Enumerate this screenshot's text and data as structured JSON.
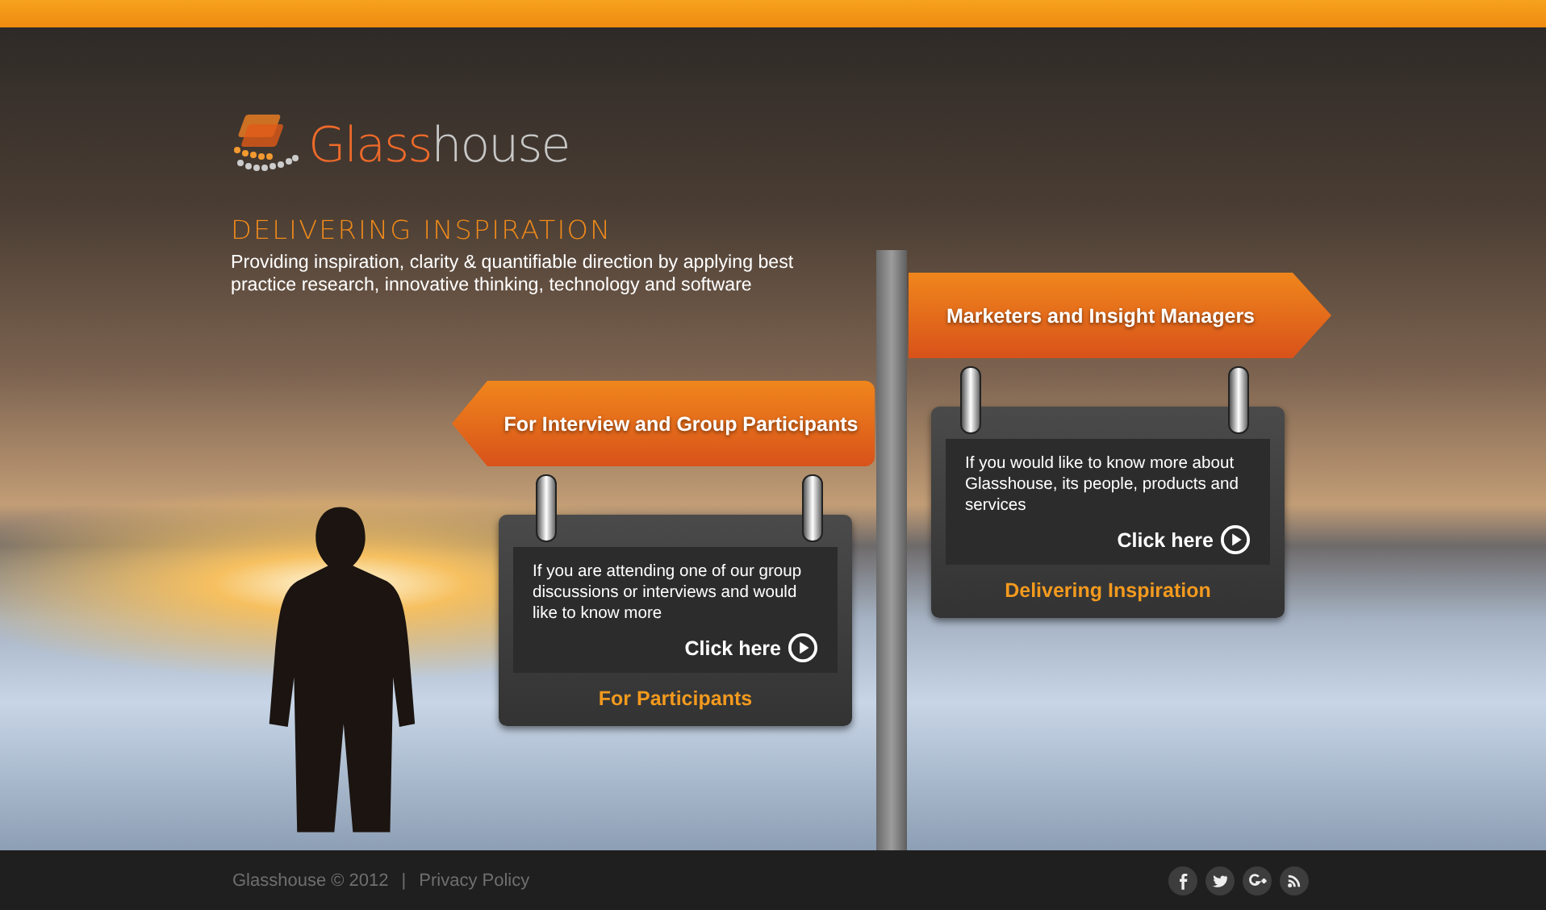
{
  "logo": {
    "prefix": "Glass",
    "suffix": "house"
  },
  "tagline": "DELIVERING INSPIRATION",
  "intro": "Providing inspiration, clarity & quantifiable direction by applying best practice research, innovative thinking, technology and software",
  "signs": [
    {
      "title": "For Interview and Group Participants",
      "kind": "left",
      "text": "If you are attending one of our group discussions or interviews and would like to know more",
      "link": "Click here",
      "footer": "For Participants"
    },
    {
      "title": "Marketers and Insight Managers",
      "kind": "right",
      "text": "If you would like to know more about Glasshouse, its people, products and services",
      "link": "Click here",
      "footer": "Delivering Inspiration"
    }
  ],
  "footer": {
    "copyright": "Glasshouse © 2012",
    "separator": "|",
    "privacy": "Privacy Policy"
  },
  "social": [
    {
      "kind": "facebook"
    },
    {
      "kind": "twitter"
    },
    {
      "kind": "googleplus"
    },
    {
      "kind": "rss"
    }
  ]
}
